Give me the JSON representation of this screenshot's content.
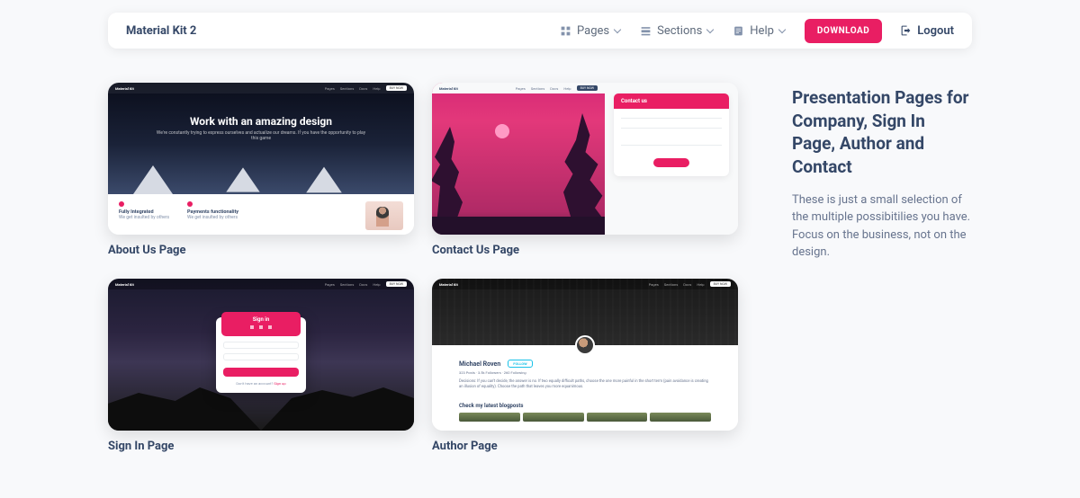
{
  "navbar": {
    "brand": "Material Kit 2",
    "pages": "Pages",
    "sections": "Sections",
    "help": "Help",
    "download": "DOWNLOAD",
    "logout": "Logout"
  },
  "side": {
    "heading": "Presentation Pages for Company, Sign In Page, Author and Contact",
    "text": "These is just a small selection of the multiple possibitilies you have. Focus on the business, not on the design."
  },
  "cards": [
    {
      "title": "About Us Page"
    },
    {
      "title": "Contact Us Page"
    },
    {
      "title": "Sign In Page"
    },
    {
      "title": "Author Page"
    }
  ],
  "thumb1": {
    "headline": "Work with an amazing design",
    "sub": "We're constantly trying to express ourselves and actualize our dreams. If you have the opportunity to play this game",
    "col1": "Fully Integrated",
    "col2": "Payments functionality"
  },
  "thumb2": {
    "heading": "Contact us"
  },
  "thumb3": {
    "heading": "Sign in",
    "footer_pre": "Don't have an account? ",
    "footer_link": "Sign up"
  },
  "thumb4": {
    "name": "Michael Roven",
    "follow": "FOLLOW",
    "meta": "323 Posts · 3.5k Followers · 260 Following",
    "desc": "Decisions: If you can't decide, the answer is no. If two equally difficult paths, choose the one more painful in the short term (pain avoidance is creating an illusion of equality). Choose the path that leaves you more equanimous.",
    "blog": "Check my latest blogposts"
  }
}
